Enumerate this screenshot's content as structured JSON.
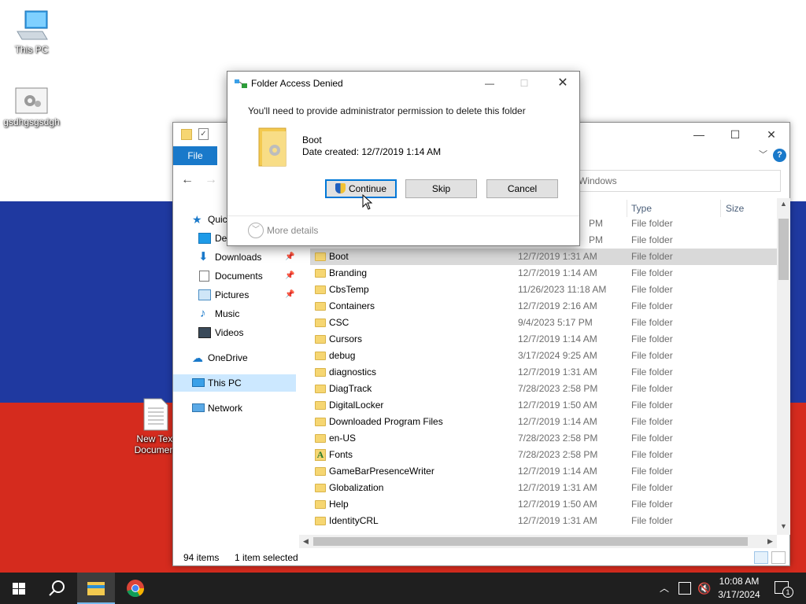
{
  "desktop": {
    "icons": [
      {
        "label": "This PC"
      },
      {
        "label": "gsdhgsgsdgh"
      },
      {
        "label": "New Text Document"
      }
    ]
  },
  "explorer": {
    "ribbon": {
      "file_tab": "File",
      "help": "?"
    },
    "search_placeholder": "Windows",
    "columns": {
      "type": "Type",
      "size": "Size"
    },
    "nav": {
      "quick_access": "Quic",
      "desktop": "Des",
      "downloads": "Downloads",
      "documents": "Documents",
      "pictures": "Pictures",
      "music": "Music",
      "videos": "Videos",
      "onedrive": "OneDrive",
      "this_pc": "This PC",
      "network": "Network"
    },
    "rows": [
      {
        "name": "",
        "date": "PM",
        "type": "File folder"
      },
      {
        "name": "",
        "date": "PM",
        "type": "File folder"
      },
      {
        "name": "Boot",
        "date": "12/7/2019 1:31 AM",
        "type": "File folder",
        "selected": true
      },
      {
        "name": "Branding",
        "date": "12/7/2019 1:14 AM",
        "type": "File folder"
      },
      {
        "name": "CbsTemp",
        "date": "11/26/2023 11:18 AM",
        "type": "File folder"
      },
      {
        "name": "Containers",
        "date": "12/7/2019 2:16 AM",
        "type": "File folder"
      },
      {
        "name": "CSC",
        "date": "9/4/2023 5:17 PM",
        "type": "File folder"
      },
      {
        "name": "Cursors",
        "date": "12/7/2019 1:14 AM",
        "type": "File folder"
      },
      {
        "name": "debug",
        "date": "3/17/2024 9:25 AM",
        "type": "File folder"
      },
      {
        "name": "diagnostics",
        "date": "12/7/2019 1:31 AM",
        "type": "File folder"
      },
      {
        "name": "DiagTrack",
        "date": "7/28/2023 2:58 PM",
        "type": "File folder"
      },
      {
        "name": "DigitalLocker",
        "date": "12/7/2019 1:50 AM",
        "type": "File folder"
      },
      {
        "name": "Downloaded Program Files",
        "date": "12/7/2019 1:14 AM",
        "type": "File folder"
      },
      {
        "name": "en-US",
        "date": "7/28/2023 2:58 PM",
        "type": "File folder"
      },
      {
        "name": "Fonts",
        "date": "7/28/2023 2:58 PM",
        "type": "File folder",
        "icon": "font-folder-icon"
      },
      {
        "name": "GameBarPresenceWriter",
        "date": "12/7/2019 1:14 AM",
        "type": "File folder"
      },
      {
        "name": "Globalization",
        "date": "12/7/2019 1:31 AM",
        "type": "File folder"
      },
      {
        "name": "Help",
        "date": "12/7/2019 1:50 AM",
        "type": "File folder"
      },
      {
        "name": "IdentityCRL",
        "date": "12/7/2019 1:31 AM",
        "type": "File folder"
      }
    ],
    "status": {
      "items": "94 items",
      "selected": "1 item selected"
    }
  },
  "dialog": {
    "title": "Folder Access Denied",
    "message": "You'll need to provide administrator permission to delete this folder",
    "folder_name": "Boot",
    "date_created": "Date created: 12/7/2019 1:14 AM",
    "buttons": {
      "continue": "Continue",
      "skip": "Skip",
      "cancel": "Cancel"
    },
    "more_details": "More details"
  },
  "taskbar": {
    "time": "10:08 AM",
    "date": "3/17/2024",
    "notification_count": "1"
  },
  "colors": {
    "flag_white": "#ffffff",
    "flag_blue": "#1f39a0",
    "flag_red": "#d52b1e",
    "accent": "#0078d7",
    "taskbar": "#1f1f1f"
  }
}
